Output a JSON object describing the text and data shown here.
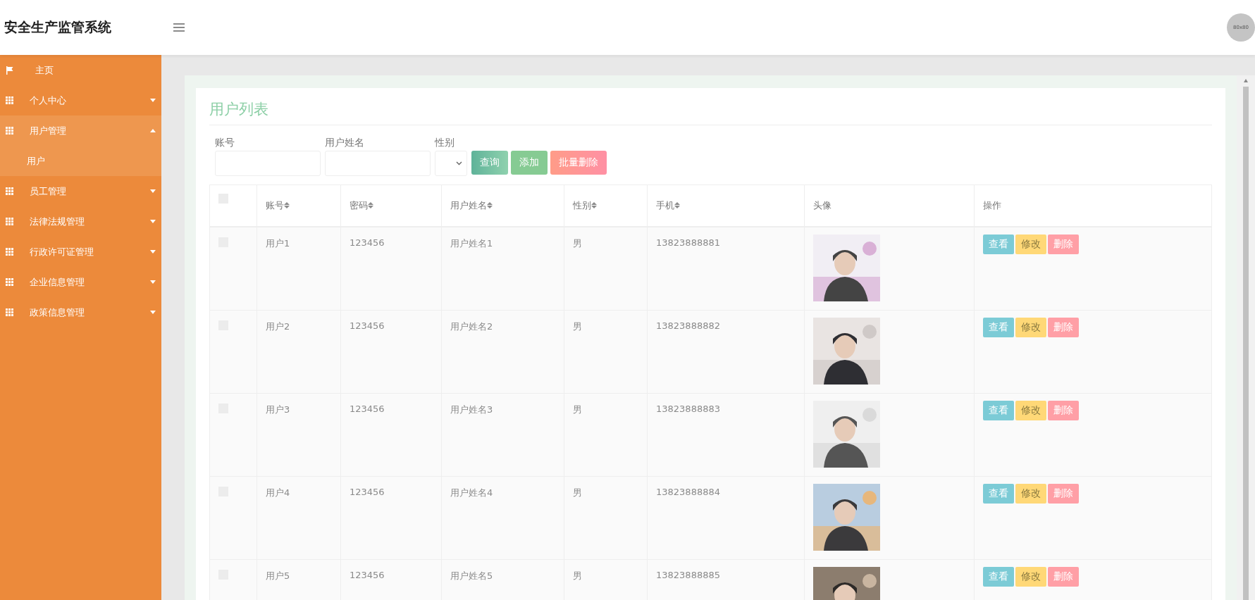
{
  "header": {
    "title": "安全生产监管系统",
    "avatar_text": "80x80"
  },
  "sidebar": {
    "items": [
      {
        "label": "主页",
        "kind": "home",
        "expanded": false
      },
      {
        "label": "个人中心",
        "kind": "menu",
        "expanded": false
      },
      {
        "label": "用户管理",
        "kind": "menu",
        "expanded": true,
        "children": [
          {
            "label": "用户",
            "selected": true
          }
        ]
      },
      {
        "label": "员工管理",
        "kind": "menu",
        "expanded": false
      },
      {
        "label": "法律法规管理",
        "kind": "menu",
        "expanded": false
      },
      {
        "label": "行政许可证管理",
        "kind": "menu",
        "expanded": false
      },
      {
        "label": "企业信息管理",
        "kind": "menu",
        "expanded": false
      },
      {
        "label": "政策信息管理",
        "kind": "menu",
        "expanded": false
      }
    ]
  },
  "page": {
    "title": "用户列表",
    "filters": [
      {
        "label": "账号",
        "kind": "text"
      },
      {
        "label": "用户姓名",
        "kind": "text"
      },
      {
        "label": "性别",
        "kind": "select"
      }
    ],
    "buttons": [
      {
        "label": "查询",
        "kind": "search"
      },
      {
        "label": "添加",
        "kind": "add"
      },
      {
        "label": "批量删除",
        "kind": "delete"
      }
    ],
    "table": {
      "select_all": {
        "checked": false
      },
      "columns": [
        {
          "label": "账号",
          "sortable": true
        },
        {
          "label": "密码",
          "sortable": true
        },
        {
          "label": "用户姓名",
          "sortable": true
        },
        {
          "label": "性别",
          "sortable": true
        },
        {
          "label": "手机",
          "sortable": true
        },
        {
          "label": "头像",
          "sortable": false
        },
        {
          "label": "操作",
          "sortable": false
        }
      ],
      "rows": [
        {
          "checked": false,
          "cells": [
            "用户1",
            "123456",
            "用户姓名1",
            "男",
            "13823888881"
          ],
          "actions": [
            {
              "label": "查看",
              "kind": "view"
            },
            {
              "label": "修改",
              "kind": "edit"
            },
            {
              "label": "删除",
              "kind": "delete"
            }
          ]
        },
        {
          "checked": false,
          "cells": [
            "用户2",
            "123456",
            "用户姓名2",
            "男",
            "13823888882"
          ],
          "actions": [
            {
              "label": "查看",
              "kind": "view"
            },
            {
              "label": "修改",
              "kind": "edit"
            },
            {
              "label": "删除",
              "kind": "delete"
            }
          ]
        },
        {
          "checked": false,
          "cells": [
            "用户3",
            "123456",
            "用户姓名3",
            "男",
            "13823888883"
          ],
          "actions": [
            {
              "label": "查看",
              "kind": "view"
            },
            {
              "label": "修改",
              "kind": "edit"
            },
            {
              "label": "删除",
              "kind": "delete"
            }
          ]
        },
        {
          "checked": false,
          "cells": [
            "用户4",
            "123456",
            "用户姓名4",
            "男",
            "13823888884"
          ],
          "actions": [
            {
              "label": "查看",
              "kind": "view"
            },
            {
              "label": "修改",
              "kind": "edit"
            },
            {
              "label": "删除",
              "kind": "delete"
            }
          ]
        },
        {
          "checked": false,
          "cells": [
            "用户5",
            "123456",
            "用户姓名5",
            "男",
            "13823888885"
          ],
          "actions": [
            {
              "label": "查看",
              "kind": "view"
            },
            {
              "label": "修改",
              "kind": "edit"
            },
            {
              "label": "删除",
              "kind": "delete"
            }
          ]
        }
      ]
    }
  }
}
